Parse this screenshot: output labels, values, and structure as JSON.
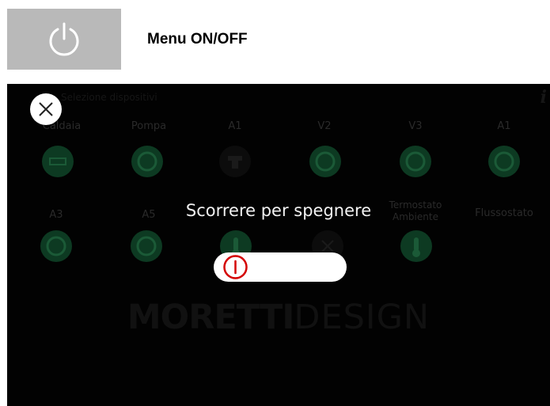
{
  "header": {
    "title": "Menu ON/OFF"
  },
  "screen": {
    "top_hint": "Selezione dispositivi",
    "row1": [
      {
        "label": "Caldaia"
      },
      {
        "label": "Pompa"
      },
      {
        "label": "A1"
      },
      {
        "label": "V2"
      },
      {
        "label": "V3"
      },
      {
        "label": "A1"
      }
    ],
    "row2": [
      {
        "label": "A3"
      },
      {
        "label": "A5"
      },
      {
        "label": ""
      },
      {
        "label": ""
      },
      {
        "label": "Termostato Ambiente"
      },
      {
        "label": "Flussostato"
      }
    ],
    "overlay_text": "Scorrere per spegnere",
    "logo_bold": "MORETTI",
    "logo_light": "DESIGN"
  },
  "colors": {
    "dim_green": "#0d3a22",
    "slider_red": "#d40000"
  }
}
